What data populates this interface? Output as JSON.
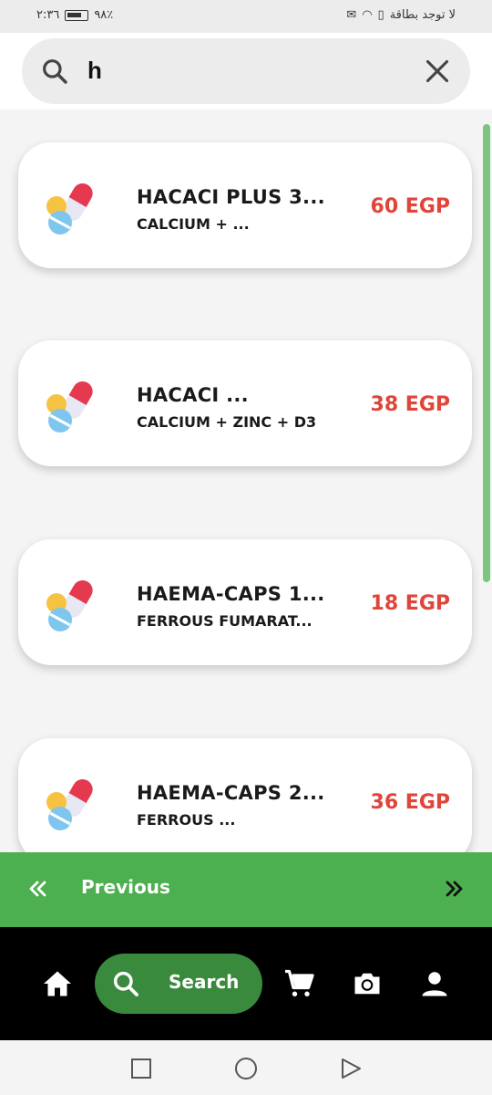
{
  "status_bar": {
    "time": "٢:٣٦",
    "battery_percent": "٩٨٪",
    "carrier": "لا توجد بطاقة"
  },
  "search": {
    "query": "h",
    "placeholder": ""
  },
  "results": [
    {
      "name": "HACACI PLUS 3...",
      "ingredient": "CALCIUM + ...",
      "price": "60 EGP"
    },
    {
      "name": "HACACI ...",
      "ingredient": "CALCIUM + ZINC + D3",
      "price": "38 EGP"
    },
    {
      "name": "HAEMA-CAPS 1...",
      "ingredient": "FERROUS FUMARAT...",
      "price": "18 EGP"
    },
    {
      "name": "HAEMA-CAPS 2...",
      "ingredient": "FERROUS ...",
      "price": "36 EGP"
    }
  ],
  "pager": {
    "previous_label": "Previous"
  },
  "bottom_nav": {
    "search_label": "Search",
    "items": [
      "home-icon",
      "search-icon",
      "cart-icon",
      "camera-icon",
      "person-icon"
    ]
  },
  "colors": {
    "accent_green": "#4caf50",
    "nav_active_green": "#3a8a3e",
    "price_red": "#e0453a"
  }
}
